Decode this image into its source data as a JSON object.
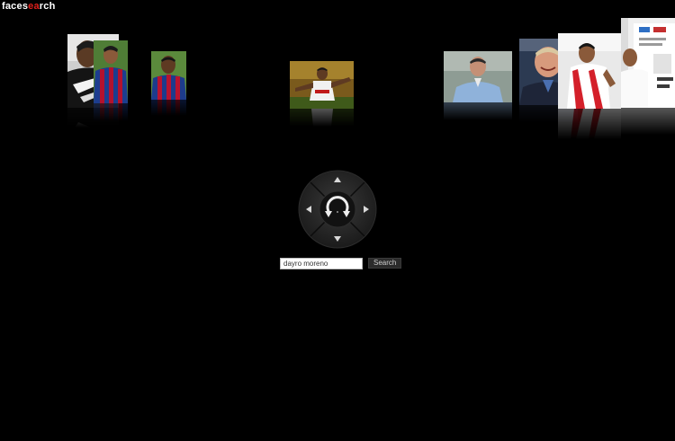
{
  "app": {
    "logo_prefix": "faces",
    "logo_accent": "ea",
    "logo_suffix": "rch",
    "accent_color": "#e0201c"
  },
  "search": {
    "value": "dayro moreno",
    "button_label": "Search"
  },
  "nav": {
    "up_icon": "arrow-up-icon",
    "down_icon": "arrow-down-icon",
    "left_icon": "arrow-left-icon",
    "right_icon": "arrow-right-icon",
    "center_icon": "rotate-icon"
  },
  "photos": [
    {
      "subject": "player in black and white kit"
    },
    {
      "subject": "player in blue and red striped shirt"
    },
    {
      "subject": "player in blue and red striped shirt"
    },
    {
      "subject": "player celebrating on pitch"
    },
    {
      "subject": "man in light blue shirt"
    },
    {
      "subject": "smiling man in dark suit"
    },
    {
      "subject": "player in red and white shirt"
    },
    {
      "subject": "player in white shirt"
    }
  ]
}
